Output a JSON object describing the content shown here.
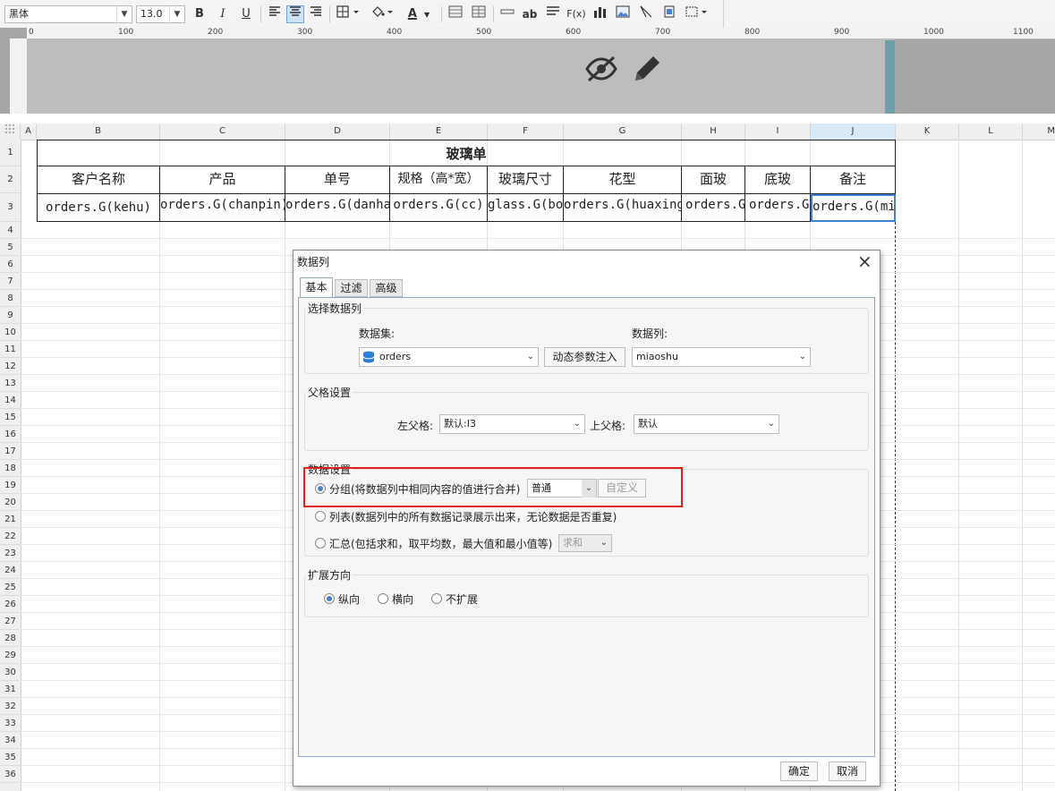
{
  "toolbar": {
    "font_name": "黑体",
    "font_size": "13.0",
    "bold": "B",
    "italic": "I",
    "underline": "U",
    "text_color_glyph": "A",
    "wrap_glyph": "ab",
    "formula_glyph": "F(x)"
  },
  "ruler": {
    "ticks": [
      "0",
      "100",
      "200",
      "300",
      "400",
      "500",
      "600",
      "700",
      "800",
      "900",
      "1000",
      "1100"
    ]
  },
  "columns": [
    "A",
    "B",
    "C",
    "D",
    "E",
    "F",
    "G",
    "H",
    "I",
    "J",
    "K",
    "L",
    "M"
  ],
  "rows": [
    "1",
    "2",
    "3",
    "4",
    "5",
    "6",
    "7",
    "8",
    "9",
    "10",
    "11",
    "12",
    "13",
    "14",
    "15",
    "16",
    "17",
    "18",
    "19",
    "20",
    "21",
    "22",
    "23",
    "24",
    "25",
    "26",
    "27",
    "28",
    "29",
    "30",
    "31",
    "32",
    "33",
    "34",
    "35",
    "36"
  ],
  "sheet": {
    "title": "玻璃单",
    "headers": [
      "客户名称",
      "产品",
      "单号",
      "规格（高*宽）",
      "玻璃尺寸",
      "花型",
      "面玻",
      "底玻",
      "备注"
    ],
    "cells": [
      "orders.G(kehu)",
      "orders.G(chanpin)",
      "orders.G(danhao)",
      "orders.G(cc)",
      "glass.G(bolichicun)",
      "orders.G(huaxing)",
      "orders.G(mianbo)",
      "orders.G(dibo)",
      "orders.G(miaoshu)"
    ]
  },
  "dialog": {
    "title": "数据列",
    "close": "×",
    "tabs": [
      "基本",
      "过滤",
      "高级"
    ],
    "select_section": {
      "title": "选择数据列",
      "dataset_label": "数据集:",
      "dataset_value": "orders",
      "dynamic_btn": "动态参数注入",
      "column_label": "数据列:",
      "column_value": "miaoshu"
    },
    "parent_section": {
      "title": "父格设置",
      "left_label": "左父格:",
      "left_value": "默认:I3",
      "up_label": "上父格:",
      "up_value": "默认"
    },
    "data_section": {
      "title": "数据设置",
      "group_label": "分组(将数据列中相同内容的值进行合并)",
      "group_mode": "普通",
      "custom_btn": "自定义",
      "list_label": "列表(数据列中的所有数据记录展示出来，无论数据是否重复)",
      "summary_label": "汇总(包括求和，取平均数，最大值和最小值等)",
      "summary_mode": "求和"
    },
    "expand_section": {
      "title": "扩展方向",
      "vertical": "纵向",
      "horizontal": "横向",
      "none": "不扩展"
    },
    "ok": "确定",
    "cancel": "取消"
  }
}
